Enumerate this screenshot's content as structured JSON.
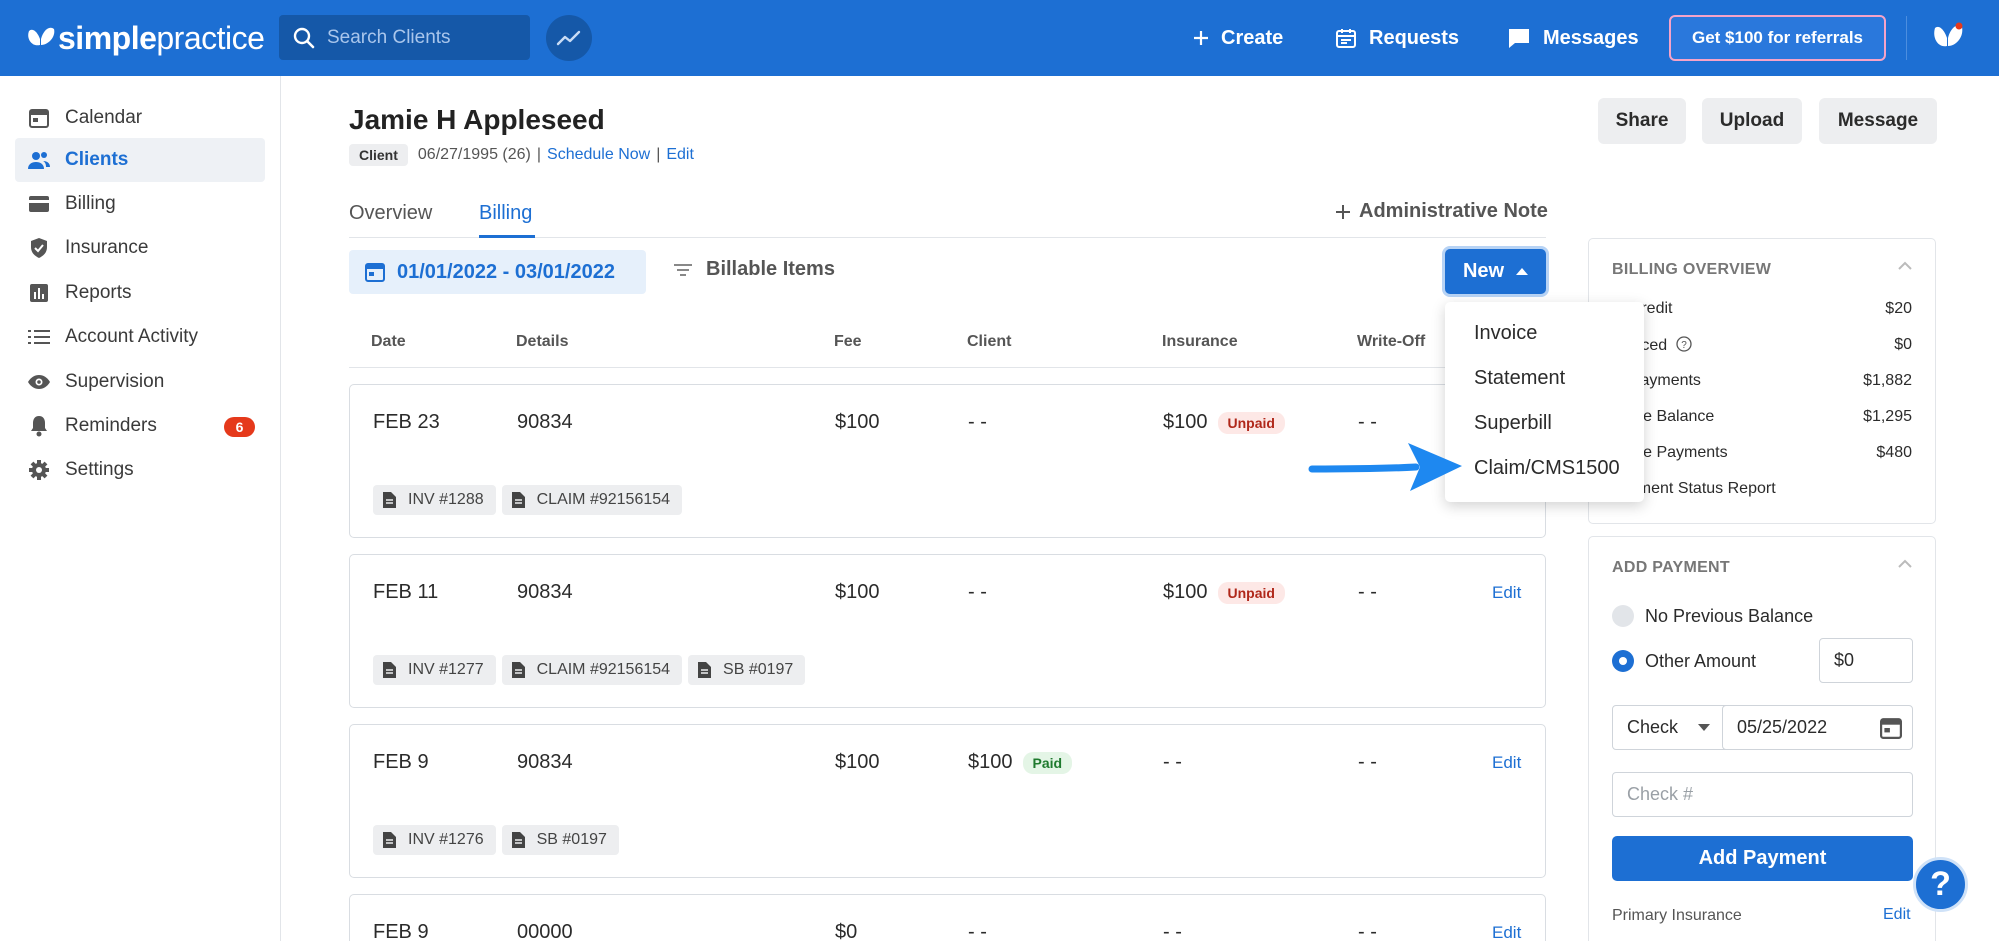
{
  "brand": {
    "bold": "simple",
    "light": "practice"
  },
  "search": {
    "placeholder": "Search Clients"
  },
  "topnav": {
    "create": "Create",
    "requests": "Requests",
    "messages": "Messages",
    "referral": "Get $100 for referrals"
  },
  "sidebar": {
    "items": [
      {
        "label": "Calendar",
        "icon": "calendar-icon"
      },
      {
        "label": "Clients",
        "icon": "clients-icon",
        "active": true
      },
      {
        "label": "Billing",
        "icon": "credit-card-icon"
      },
      {
        "label": "Insurance",
        "icon": "shield-icon"
      },
      {
        "label": "Reports",
        "icon": "bar-chart-icon"
      },
      {
        "label": "Account Activity",
        "icon": "list-icon"
      },
      {
        "label": "Supervision",
        "icon": "eye-icon"
      },
      {
        "label": "Reminders",
        "icon": "bell-icon",
        "badge": "6"
      },
      {
        "label": "Settings",
        "icon": "gear-icon"
      }
    ]
  },
  "client": {
    "name": "Jamie H Appleseed",
    "tag": "Client",
    "dob": "06/27/1995 (26)",
    "schedule": "Schedule Now",
    "edit": "Edit"
  },
  "header_buttons": {
    "share": "Share",
    "upload": "Upload",
    "message": "Message"
  },
  "tabs": {
    "overview": "Overview",
    "billing": "Billing",
    "admin_note": "Administrative Note"
  },
  "toolbar": {
    "date_range": "01/01/2022 - 03/01/2022",
    "billable": "Billable Items",
    "new": "New"
  },
  "table": {
    "columns": [
      "Date",
      "Details",
      "Fee",
      "Client",
      "Insurance",
      "Write-Off"
    ],
    "rows": [
      {
        "date": "FEB 23",
        "details": "90834",
        "fee": "$100",
        "client": "- -",
        "insurance": "$100",
        "insurance_status": "Unpaid",
        "writeoff": "- -",
        "edit": "",
        "chips": [
          "INV #1288",
          "CLAIM #92156154"
        ]
      },
      {
        "date": "FEB 11",
        "details": "90834",
        "fee": "$100",
        "client": "- -",
        "insurance": "$100",
        "insurance_status": "Unpaid",
        "writeoff": "- -",
        "edit": "Edit",
        "chips": [
          "INV #1277",
          "CLAIM #92156154",
          "SB #0197"
        ]
      },
      {
        "date": "FEB 9",
        "details": "90834",
        "fee": "$100",
        "client": "$100",
        "client_status": "Paid",
        "insurance": "- -",
        "writeoff": "- -",
        "edit": "Edit",
        "chips": [
          "INV #1276",
          "SB #0197"
        ]
      },
      {
        "date": "FEB 9",
        "details": "00000",
        "fee": "$0",
        "client": "- -",
        "insurance": "- -",
        "writeoff": "- -",
        "edit": "Edit",
        "chips": []
      }
    ]
  },
  "dropdown": {
    "items": [
      "Invoice",
      "Statement",
      "Superbill",
      "Claim/CMS1500"
    ]
  },
  "billing_overview": {
    "title": "BILLING OVERVIEW",
    "rows": [
      {
        "label": "nt Credit",
        "value": "$20"
      },
      {
        "label": "nvoiced",
        "value": "$0"
      },
      {
        "label": "nt Payments",
        "value": "$1,882"
      },
      {
        "label": "rance Balance",
        "value": "$1,295"
      },
      {
        "label": "rance Payments",
        "value": "$480"
      }
    ],
    "report_link": "ointment Status Report"
  },
  "add_payment": {
    "title": "ADD PAYMENT",
    "no_balance": "No Previous Balance",
    "other_amount": "Other Amount",
    "amount": "$0",
    "method": "Check",
    "date": "05/25/2022",
    "check_placeholder": "Check #",
    "button": "Add Payment",
    "primary_insurance": "Primary Insurance",
    "edit": "Edit"
  },
  "help": "?",
  "colors": {
    "brand_blue": "#1d6fd3",
    "unpaid": "#b0281a",
    "paid": "#1f7a2e",
    "badge": "#e5391b"
  }
}
